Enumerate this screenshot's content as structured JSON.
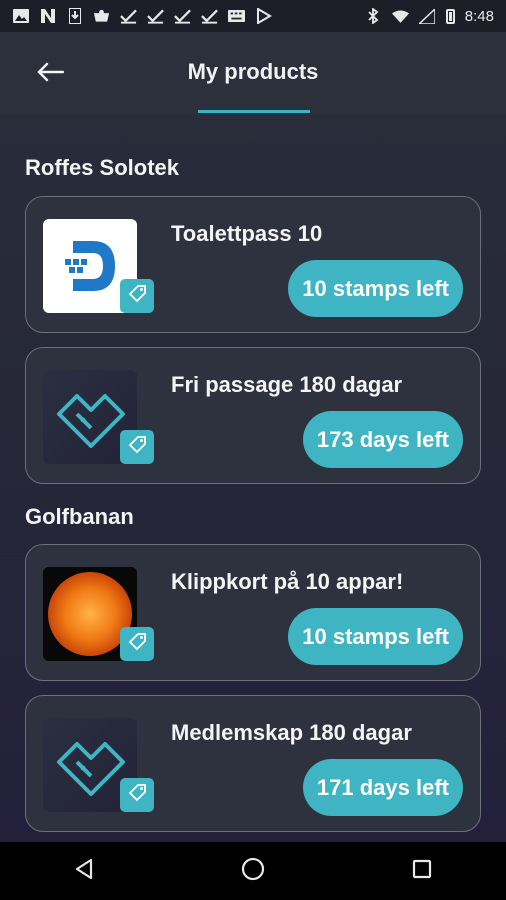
{
  "status_bar": {
    "time": "8:48",
    "left_icons": [
      "image-icon",
      "n-icon",
      "download-icon",
      "cup-icon",
      "check-icon",
      "check-icon",
      "check-icon",
      "check-icon",
      "keyboard-icon",
      "play-store-icon"
    ],
    "right_icons": [
      "bluetooth-icon",
      "wifi-icon",
      "signal-icon",
      "battery-icon"
    ]
  },
  "header": {
    "title": "My products",
    "back_icon": "arrow-left-icon"
  },
  "sections": [
    {
      "title": "Roffes Solotek",
      "products": [
        {
          "name": "Toalettpass 10",
          "status": "10 stamps left",
          "thumb": "logo-d"
        },
        {
          "name": "Fri passage 180 dagar",
          "status": "173 days left",
          "thumb": "app-logo"
        }
      ]
    },
    {
      "title": "Golfbanan",
      "products": [
        {
          "name": "Klippkort på 10 appar!",
          "status": "10 stamps left",
          "thumb": "sun-photo"
        },
        {
          "name": "Medlemskap 180 dagar",
          "status": "171 days left",
          "thumb": "app-logo"
        }
      ]
    }
  ],
  "nav": {
    "back": "nav-back-icon",
    "home": "nav-home-icon",
    "recents": "nav-recents-icon"
  },
  "colors": {
    "accent": "#3fb5c4",
    "card_bg": "#2d323e",
    "card_border": "#6b707c"
  }
}
